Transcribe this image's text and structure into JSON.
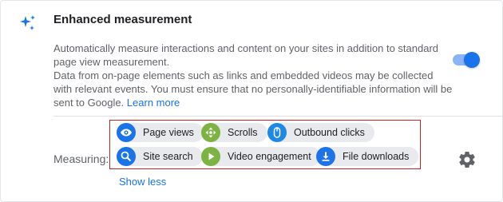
{
  "section": {
    "title": "Enhanced measurement",
    "description_line1": "Automatically measure interactions and content on your sites in addition to standard page view measurement.",
    "description_line2": "Data from on-page elements such as links and embedded videos may be collected with relevant events. You must ensure that no personally-identifiable information will be sent to Google.",
    "learn_more": "Learn more",
    "toggle_state": "on"
  },
  "measuring": {
    "label": "Measuring:",
    "chips": [
      {
        "label": "Page views",
        "icon": "eye-icon",
        "color": "#1a73e8"
      },
      {
        "label": "Scrolls",
        "icon": "scroll-arrows-icon",
        "color": "#7cb342"
      },
      {
        "label": "Outbound clicks",
        "icon": "mouse-icon",
        "color": "#1e88e5"
      },
      {
        "label": "Site search",
        "icon": "search-icon",
        "color": "#1a73e8"
      },
      {
        "label": "Video engagement",
        "icon": "play-icon",
        "color": "#7cb342"
      },
      {
        "label": "File downloads",
        "icon": "download-icon",
        "color": "#1e73e8"
      }
    ]
  },
  "show_less": "Show less",
  "colors": {
    "accent": "#1a73e8",
    "toggle_track": "#8ab4f8",
    "highlight_border": "#c5221f",
    "chip_bg": "#e8eaed"
  }
}
